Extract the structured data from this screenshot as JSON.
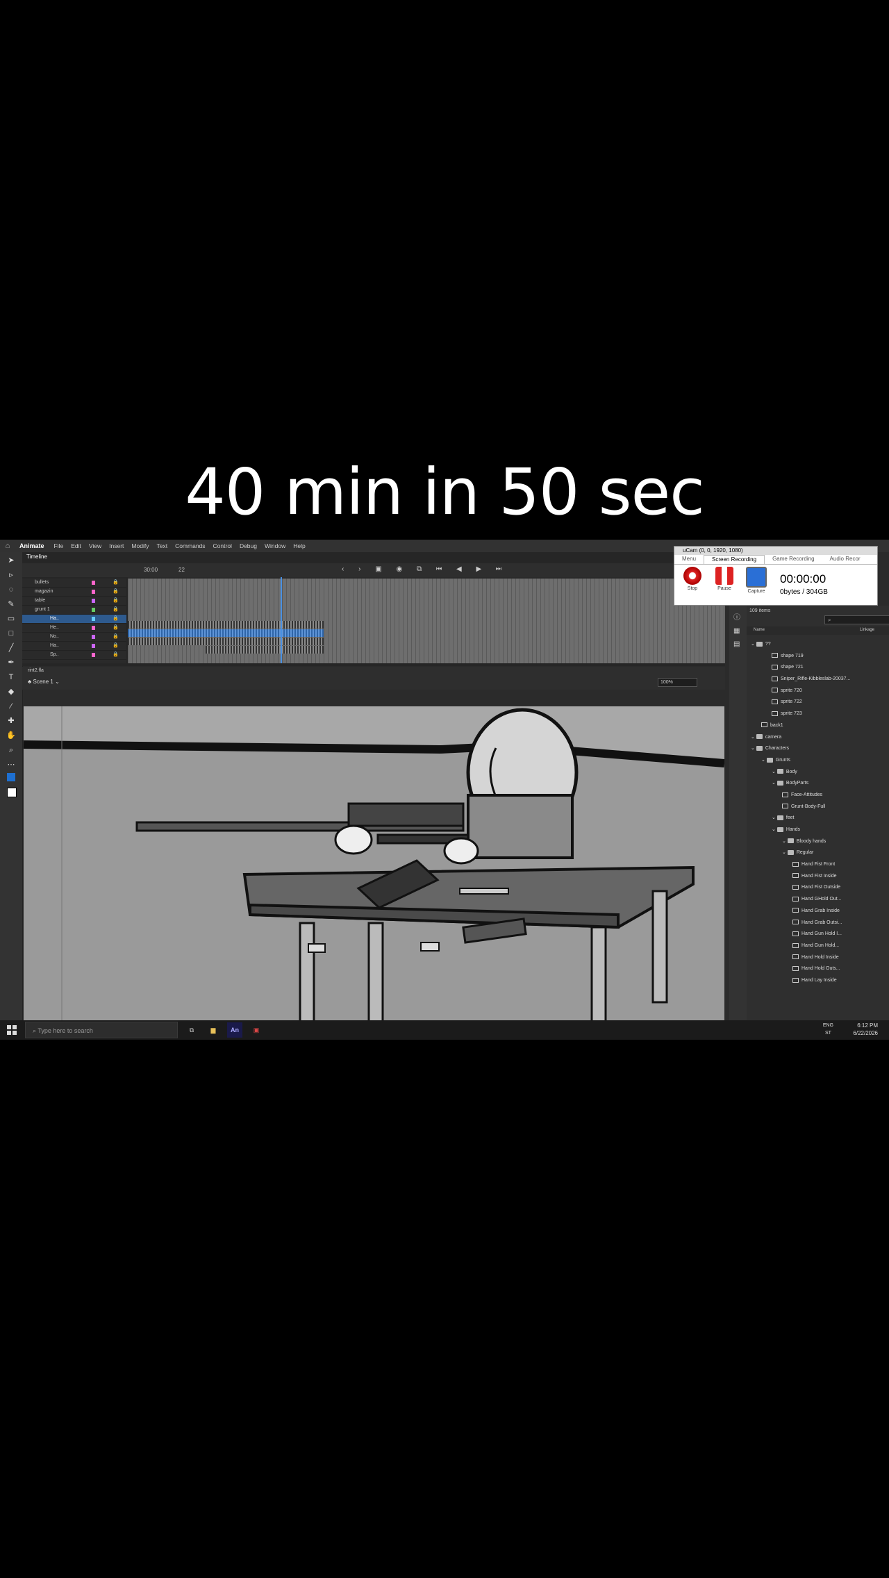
{
  "caption": "40 min in 50 sec",
  "app": {
    "name": "Animate",
    "menu": [
      "File",
      "Edit",
      "View",
      "Insert",
      "Modify",
      "Text",
      "Commands",
      "Control",
      "Debug",
      "Window",
      "Help"
    ]
  },
  "timeline": {
    "tab_label": "Timeline",
    "frame_time": "30:00",
    "fps": "22",
    "layers": [
      {
        "label": "bullets",
        "color": "#ff66cc"
      },
      {
        "label": "magazin",
        "color": "#ff66cc"
      },
      {
        "label": "table",
        "color": "#cc66ff"
      },
      {
        "label": "grunt 1",
        "color": "#66cc66"
      },
      {
        "label": "Ha..",
        "color": "#66ccff"
      },
      {
        "label": "He..",
        "color": "#ff66cc"
      },
      {
        "label": "No..",
        "color": "#cc66ff"
      },
      {
        "label": "Ha..",
        "color": "#cc66ff"
      },
      {
        "label": "Sp..",
        "color": "#ff66cc"
      }
    ]
  },
  "stage": {
    "file_tab": "rint2.fla",
    "scene_label": "Scene 1",
    "zoom": "100%"
  },
  "library": {
    "count": "109 items",
    "col_name": "Name",
    "col_linkage": "Linkage",
    "items": [
      {
        "label": "??",
        "kind": "folder",
        "depth": 0
      },
      {
        "label": "shape 719",
        "kind": "symbol",
        "depth": 2
      },
      {
        "label": "shape 721",
        "kind": "symbol",
        "depth": 2
      },
      {
        "label": "Sniper_Rifle-Kibbleslab-20037...",
        "kind": "symbol",
        "depth": 2
      },
      {
        "label": "sprite 720",
        "kind": "symbol",
        "depth": 2
      },
      {
        "label": "sprite 722",
        "kind": "symbol",
        "depth": 2
      },
      {
        "label": "sprite 723",
        "kind": "symbol",
        "depth": 2
      },
      {
        "label": "back1",
        "kind": "symbol",
        "depth": 1
      },
      {
        "label": "camera",
        "kind": "folder",
        "depth": 0
      },
      {
        "label": "Characters",
        "kind": "folder",
        "depth": 0
      },
      {
        "label": "Grunts",
        "kind": "folder",
        "depth": 1
      },
      {
        "label": "Body",
        "kind": "folder",
        "depth": 2
      },
      {
        "label": "BodyParts",
        "kind": "folder",
        "depth": 2
      },
      {
        "label": "Face-Attitudes",
        "kind": "symbol",
        "depth": 3
      },
      {
        "label": "Grunt-Body-Full",
        "kind": "symbol",
        "depth": 3
      },
      {
        "label": "feet",
        "kind": "folder",
        "depth": 2
      },
      {
        "label": "Hands",
        "kind": "folder",
        "depth": 2
      },
      {
        "label": "Bloody hands",
        "kind": "folder",
        "depth": 3
      },
      {
        "label": "Regular",
        "kind": "folder",
        "depth": 3
      },
      {
        "label": "Hand Fist Front",
        "kind": "symbol",
        "depth": 4
      },
      {
        "label": "Hand Fist Inside",
        "kind": "symbol",
        "depth": 4
      },
      {
        "label": "Hand Fist Outside",
        "kind": "symbol",
        "depth": 4
      },
      {
        "label": "Hand GHold Out...",
        "kind": "symbol",
        "depth": 4
      },
      {
        "label": "Hand Grab Inside",
        "kind": "symbol",
        "depth": 4
      },
      {
        "label": "Hand Grab Outsi...",
        "kind": "symbol",
        "depth": 4
      },
      {
        "label": "Hand Gun Hold I...",
        "kind": "symbol",
        "depth": 4
      },
      {
        "label": "Hand Gun Hold...",
        "kind": "symbol",
        "depth": 4
      },
      {
        "label": "Hand Hold Inside",
        "kind": "symbol",
        "depth": 4
      },
      {
        "label": "Hand Hold Outs...",
        "kind": "symbol",
        "depth": 4
      },
      {
        "label": "Hand Lay Inside",
        "kind": "symbol",
        "depth": 4
      }
    ]
  },
  "ucam": {
    "title": "uCam (0, 0, 1920, 1080)",
    "tabs": [
      "Menu",
      "Screen Recording",
      "Game Recording",
      "Audio Recor"
    ],
    "buttons": [
      "Stop",
      "Pause",
      "Capture"
    ],
    "timer": "00:00:00",
    "size": "0bytes / 304GB"
  },
  "taskbar": {
    "search_placeholder": "Type here to search",
    "animate_icon": "An",
    "lang1": "ENG",
    "lang2": "ST",
    "time": "6:12 PM",
    "date": "6/22/2026"
  }
}
